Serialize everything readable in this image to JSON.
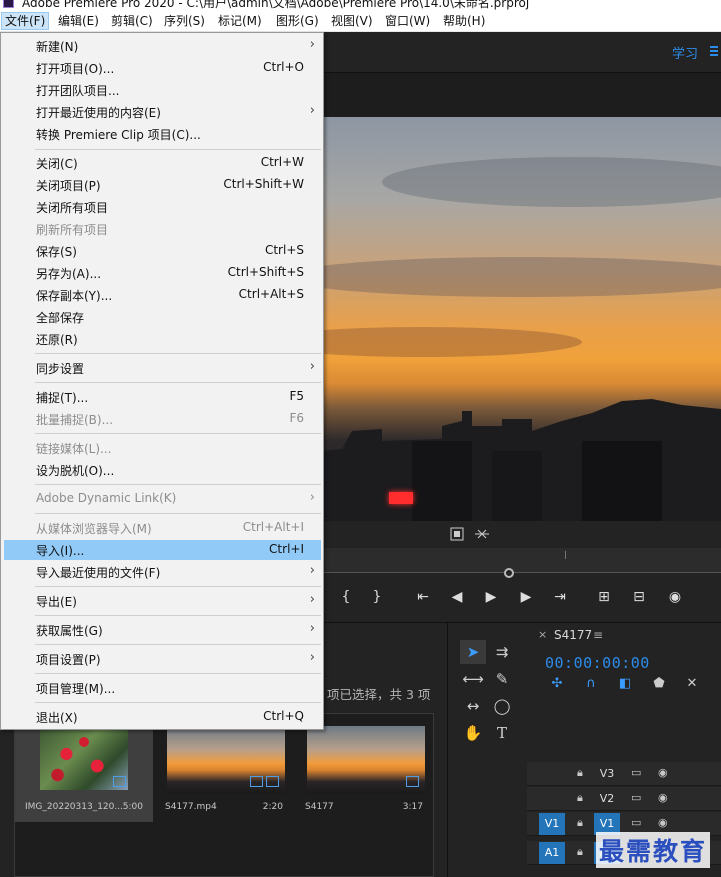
{
  "window": {
    "title": "Adobe Premiere Pro 2020 - C:\\用户\\admin\\文档\\Adobe\\Premiere Pro\\14.0\\未命名.prproj"
  },
  "menubar": [
    {
      "label": "文件(F)"
    },
    {
      "label": "编辑(E)"
    },
    {
      "label": "剪辑(C)"
    },
    {
      "label": "序列(S)"
    },
    {
      "label": "标记(M)"
    },
    {
      "label": "图形(G)"
    },
    {
      "label": "视图(V)"
    },
    {
      "label": "窗口(W)"
    },
    {
      "label": "帮助(H)"
    }
  ],
  "file_menu": {
    "items": [
      {
        "label": "新建(N)",
        "shortcut": "",
        "arrow": "›"
      },
      {
        "label": "打开项目(O)...",
        "shortcut": "Ctrl+O"
      },
      {
        "label": "打开团队项目...",
        "shortcut": ""
      },
      {
        "label": "打开最近使用的内容(E)",
        "shortcut": "",
        "arrow": "›"
      },
      {
        "label": "转换 Premiere Clip 项目(C)...",
        "shortcut": ""
      },
      {
        "label": "关闭(C)",
        "shortcut": "Ctrl+W"
      },
      {
        "label": "关闭项目(P)",
        "shortcut": "Ctrl+Shift+W"
      },
      {
        "label": "关闭所有项目",
        "shortcut": ""
      },
      {
        "label": "刷新所有项目",
        "shortcut": ""
      },
      {
        "label": "保存(S)",
        "shortcut": "Ctrl+S"
      },
      {
        "label": "另存为(A)...",
        "shortcut": "Ctrl+Shift+S"
      },
      {
        "label": "保存副本(Y)...",
        "shortcut": "Ctrl+Alt+S"
      },
      {
        "label": "全部保存",
        "shortcut": ""
      },
      {
        "label": "还原(R)",
        "shortcut": ""
      },
      {
        "label": "同步设置",
        "shortcut": "",
        "arrow": "›"
      },
      {
        "label": "捕捉(T)...",
        "shortcut": "F5"
      },
      {
        "label": "批量捕捉(B)...",
        "shortcut": "F6"
      },
      {
        "label": "链接媒体(L)...",
        "shortcut": ""
      },
      {
        "label": "设为脱机(O)...",
        "shortcut": ""
      },
      {
        "label": "Adobe Dynamic Link(K)",
        "shortcut": "",
        "arrow": "›"
      },
      {
        "label": "从媒体浏览器导入(M)",
        "shortcut": "Ctrl+Alt+I"
      },
      {
        "label": "导入(I)...",
        "shortcut": "Ctrl+I"
      },
      {
        "label": "导入最近使用的文件(F)",
        "shortcut": "",
        "arrow": "›"
      },
      {
        "label": "导出(E)",
        "shortcut": "",
        "arrow": "›"
      },
      {
        "label": "获取属性(G)",
        "shortcut": "",
        "arrow": "›"
      },
      {
        "label": "项目设置(P)",
        "shortcut": "",
        "arrow": "›"
      },
      {
        "label": "项目管理(M)...",
        "shortcut": ""
      },
      {
        "label": "退出(X)",
        "shortcut": "Ctrl+Q"
      }
    ]
  },
  "workspace": {
    "learn_label": "学习"
  },
  "project_panel": {
    "selection_info": "项已选择，共 3 项",
    "clips": [
      {
        "name": "IMG_20220313_120...",
        "duration": "5:00"
      },
      {
        "name": "S4177.mp4",
        "duration": "2:20"
      },
      {
        "name": "S4177",
        "duration": "3:17"
      }
    ]
  },
  "timeline": {
    "close": "×",
    "sequence_name": "S4177",
    "menu": "≡",
    "timecode": "00:00:00:00",
    "tracks": [
      {
        "source": "",
        "label": "V3"
      },
      {
        "source": "",
        "label": "V2"
      },
      {
        "source": "V1",
        "label": "V1"
      },
      {
        "source": "A1",
        "label": "A1"
      }
    ]
  },
  "watermark": "最需教育",
  "colors": {
    "accent": "#2d8ceb",
    "menu_highlight": "#91c9f7",
    "track_on": "#2374b8"
  }
}
